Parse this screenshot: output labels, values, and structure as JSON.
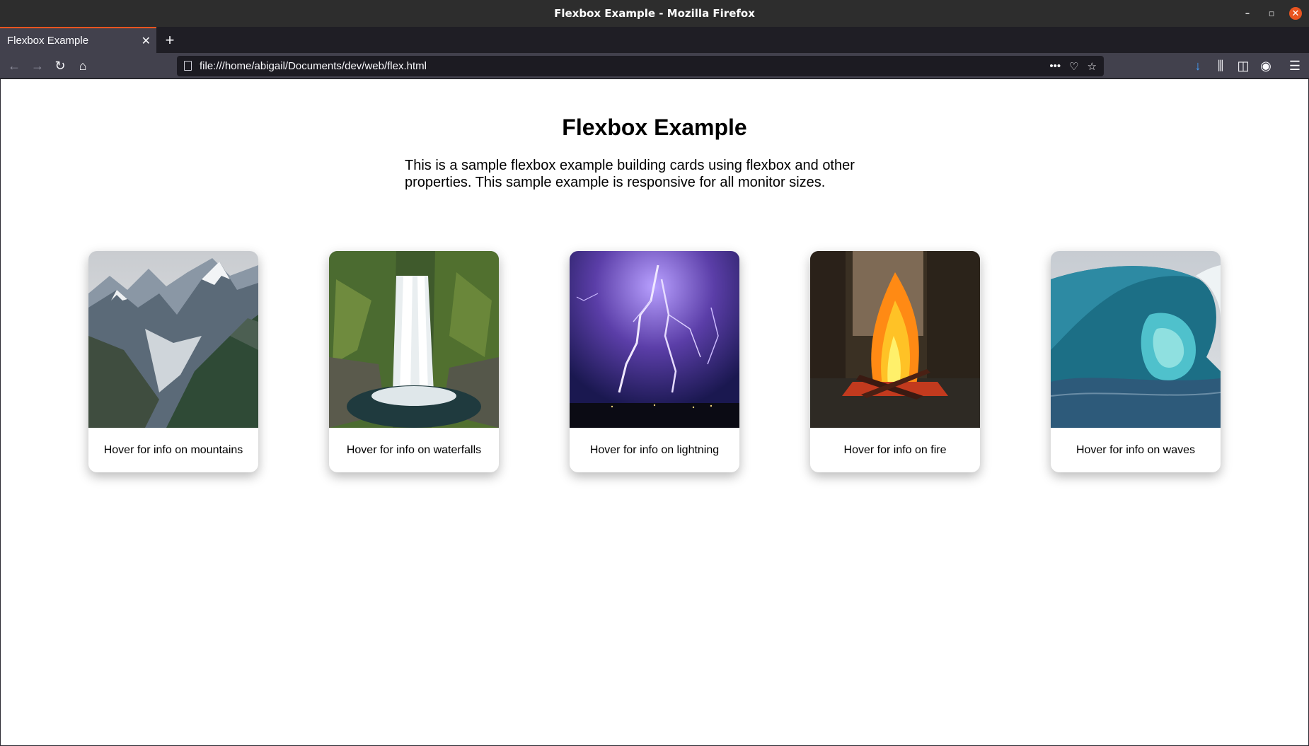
{
  "window": {
    "title": "Flexbox Example - Mozilla Firefox",
    "controls": {
      "minimize": "–",
      "maximize": "▫",
      "close": "✕"
    }
  },
  "tabs": [
    {
      "label": "Flexbox Example",
      "close": "✕",
      "active": true
    }
  ],
  "new_tab": "+",
  "nav": {
    "back": "←",
    "forward": "→",
    "reload": "↻",
    "home": "⌂",
    "url": "file:///home/abigail/Documents/dev/web/flex.html",
    "page_actions": "•••",
    "pocket": "♡",
    "bookmark": "☆",
    "downloads": "↓",
    "library": "⫼",
    "sidebar": "◫",
    "account": "◉",
    "menu": "☰"
  },
  "page": {
    "heading": "Flexbox Example",
    "intro_line1": "This is a sample flexbox example building cards using flexbox and other",
    "intro_line2": "properties. This sample example is responsive for all monitor sizes.",
    "cards": [
      {
        "caption": "Hover for info on mountains",
        "image": "mountains"
      },
      {
        "caption": "Hover for info on waterfalls",
        "image": "waterfall"
      },
      {
        "caption": "Hover for info on lightning",
        "image": "lightning"
      },
      {
        "caption": "Hover for info on fire",
        "image": "fire"
      },
      {
        "caption": "Hover for info on waves",
        "image": "wave"
      }
    ]
  },
  "colors": {
    "accent": "#e95420",
    "toolbar": "#42414d",
    "urlbar": "#1c1b22",
    "download_active": "#45a1ff"
  }
}
